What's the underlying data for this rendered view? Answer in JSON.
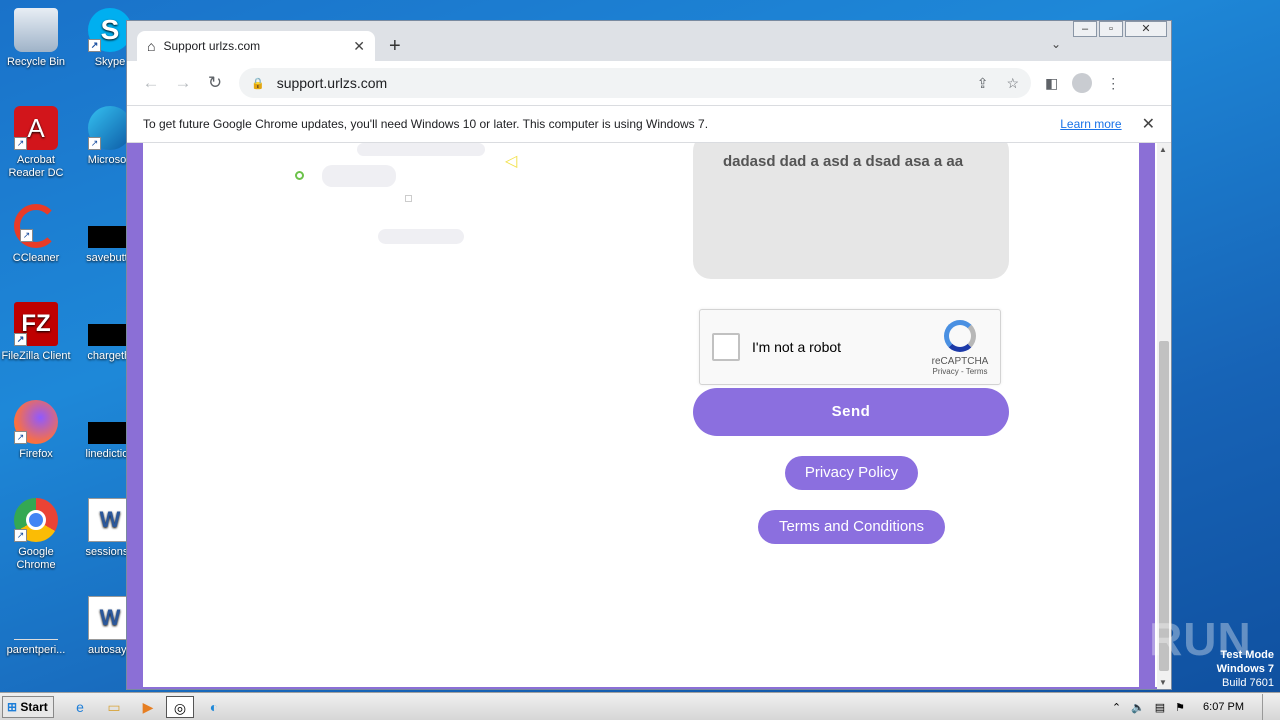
{
  "desktop": {
    "icons": [
      {
        "label": "Recycle Bin",
        "glyph": "🗑"
      },
      {
        "label": "Skype",
        "glyph": "S"
      },
      {
        "label": "Acrobat Reader DC",
        "glyph": "A"
      },
      {
        "label": "Microsoft",
        "glyph": "e"
      },
      {
        "label": "CCleaner",
        "glyph": "C"
      },
      {
        "label": "savebutto",
        "glyph": ""
      },
      {
        "label": "FileZilla Client",
        "glyph": "FZ"
      },
      {
        "label": "chargethi",
        "glyph": ""
      },
      {
        "label": "Firefox",
        "glyph": "🦊"
      },
      {
        "label": "linediction",
        "glyph": ""
      },
      {
        "label": "Google Chrome",
        "glyph": "◎"
      },
      {
        "label": "sessionsu",
        "glyph": "W"
      },
      {
        "label": "parentperi...",
        "glyph": ""
      },
      {
        "label": "autosays",
        "glyph": "W"
      }
    ]
  },
  "browser": {
    "tab_title": "Support urlzs.com",
    "url": "support.urlzs.com",
    "infobar_message": "To get future Google Chrome updates, you'll need Windows 10 or later. This computer is using Windows 7.",
    "infobar_link": "Learn more"
  },
  "page": {
    "message_text": "dadasd  dad a asd a dsad asa a aa",
    "recaptcha_label": "I'm not a robot",
    "recaptcha_brand": "reCAPTCHA",
    "recaptcha_links": "Privacy - Terms",
    "send_label": "Send",
    "privacy_label": "Privacy Policy",
    "terms_label": "Terms and Conditions",
    "accent_color": "#8b6fdf"
  },
  "watermark": {
    "brand": "ANY RUN",
    "test_mode": "Test Mode",
    "os": "Windows 7",
    "build": "Build 7601"
  },
  "taskbar": {
    "start_label": "Start",
    "clock": "6:07 PM"
  }
}
